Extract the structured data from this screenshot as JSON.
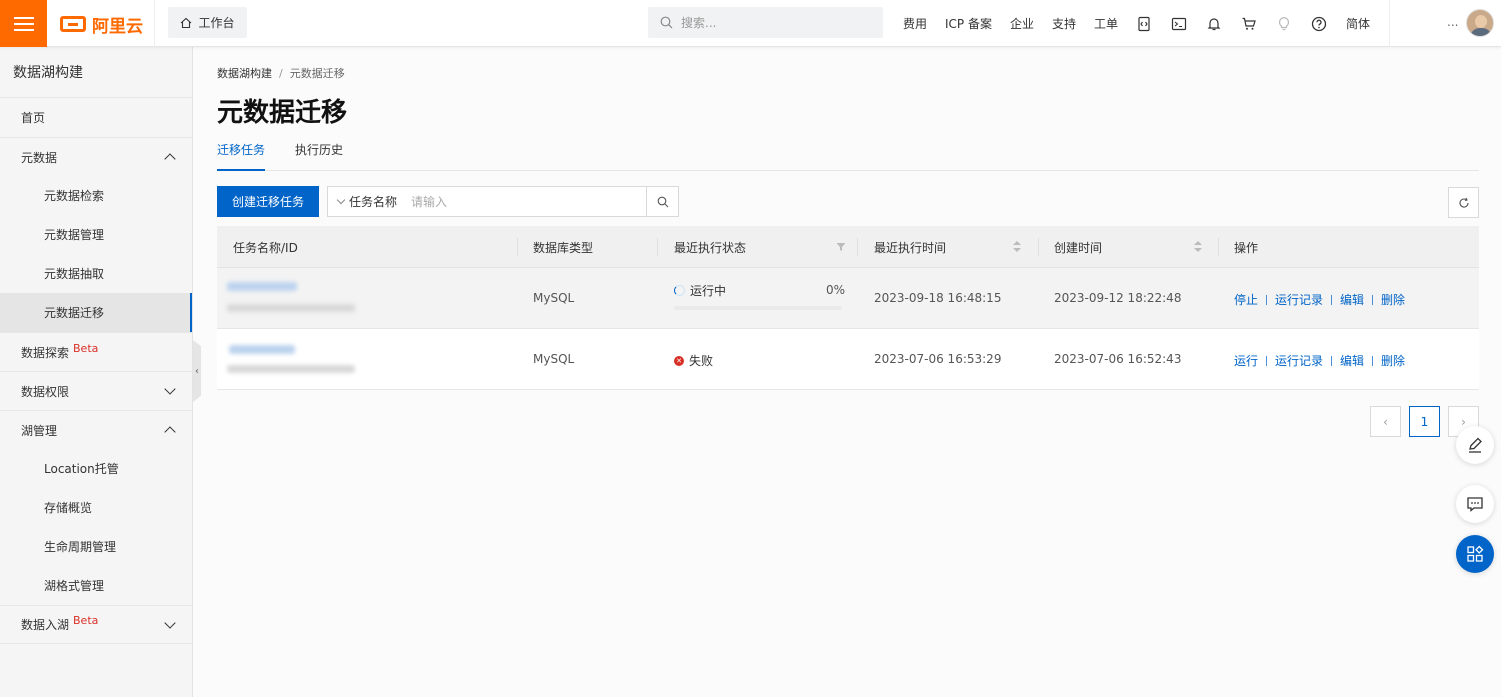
{
  "header": {
    "brand": "阿里云",
    "workbench": "工作台",
    "search_placeholder": "搜索...",
    "nav": [
      "费用",
      "ICP 备案",
      "企业",
      "支持",
      "工单"
    ],
    "lang": "简体",
    "more": "..."
  },
  "sidebar": {
    "title": "数据湖构建",
    "items": [
      {
        "label": "首页"
      },
      {
        "label": "元数据"
      },
      {
        "label": "元数据检索"
      },
      {
        "label": "元数据管理"
      },
      {
        "label": "元数据抽取"
      },
      {
        "label": "元数据迁移"
      },
      {
        "label": "数据探索",
        "badge": "Beta"
      },
      {
        "label": "数据权限"
      },
      {
        "label": "湖管理"
      },
      {
        "label": "Location托管"
      },
      {
        "label": "存储概览"
      },
      {
        "label": "生命周期管理"
      },
      {
        "label": "湖格式管理"
      },
      {
        "label": "数据入湖",
        "badge": "Beta"
      }
    ]
  },
  "breadcrumb": {
    "root": "数据湖构建",
    "sep": "/",
    "current": "元数据迁移"
  },
  "page_title": "元数据迁移",
  "tabs": [
    "迁移任务",
    "执行历史"
  ],
  "toolbar": {
    "create_label": "创建迁移任务",
    "filter_field": "任务名称",
    "filter_placeholder": "请输入"
  },
  "table": {
    "columns": [
      "任务名称/ID",
      "数据库类型",
      "最近执行状态",
      "最近执行时间",
      "创建时间",
      "操作"
    ],
    "rows": [
      {
        "db_type": "MySQL",
        "status": "运行中",
        "progress_label": "0%",
        "progress": 0,
        "last_run": "2023-09-18 16:48:15",
        "created": "2023-09-12 18:22:48",
        "actions": [
          "停止",
          "运行记录",
          "编辑",
          "删除"
        ]
      },
      {
        "db_type": "MySQL",
        "status": "失败",
        "last_run": "2023-07-06 16:53:29",
        "created": "2023-07-06 16:52:43",
        "actions": [
          "运行",
          "运行记录",
          "编辑",
          "删除"
        ]
      }
    ]
  },
  "pagination": {
    "current": "1"
  },
  "colors": {
    "brand": "#ff6a00",
    "primary": "#0064c8",
    "error": "#d93026"
  }
}
